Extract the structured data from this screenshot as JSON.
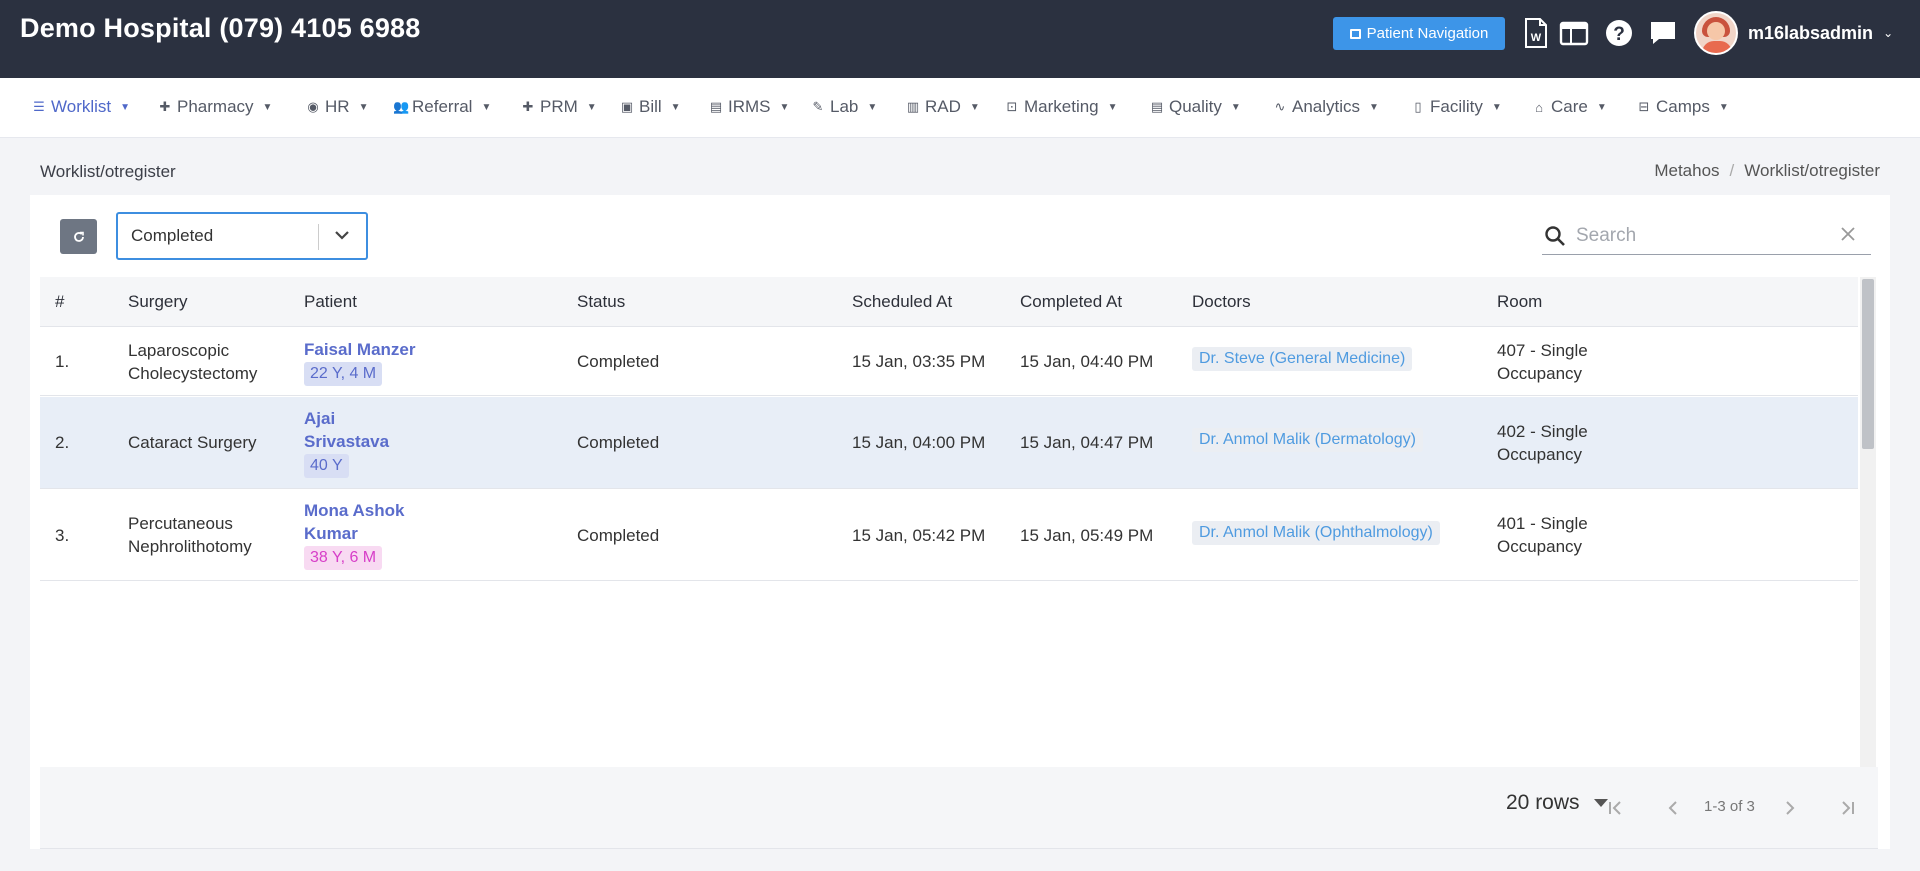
{
  "header": {
    "title": "Demo Hospital (079) 4105 6988",
    "patient_navigation": "Patient Navigation",
    "username": "m16labsadmin"
  },
  "nav": [
    {
      "label": "Worklist",
      "icon": "list-icon"
    },
    {
      "label": "Pharmacy",
      "icon": "plus-icon"
    },
    {
      "label": "HR",
      "icon": "user-circle-icon"
    },
    {
      "label": "Referral",
      "icon": "users-icon"
    },
    {
      "label": "PRM",
      "icon": "plus-icon"
    },
    {
      "label": "Bill",
      "icon": "bill-icon"
    },
    {
      "label": "IRMS",
      "icon": "id-card-icon"
    },
    {
      "label": "Lab",
      "icon": "pen-icon"
    },
    {
      "label": "RAD",
      "icon": "film-icon"
    },
    {
      "label": "Marketing",
      "icon": "bag-icon"
    },
    {
      "label": "Quality",
      "icon": "id-card-icon"
    },
    {
      "label": "Analytics",
      "icon": "pulse-icon"
    },
    {
      "label": "Facility",
      "icon": "building-icon"
    },
    {
      "label": "Care",
      "icon": "store-icon"
    },
    {
      "label": "Camps",
      "icon": "briefcase-icon"
    }
  ],
  "page": {
    "title": "Worklist/otregister",
    "breadcrumb": [
      "Metahos",
      "Worklist/otregister"
    ]
  },
  "filter": {
    "status_selected": "Completed",
    "search_placeholder": "Search"
  },
  "table": {
    "columns": [
      "#",
      "Surgery",
      "Patient",
      "Status",
      "Scheduled At",
      "Completed At",
      "Doctors",
      "Room"
    ],
    "rows": [
      {
        "num": "1.",
        "surgery": [
          "Laparoscopic",
          "Cholecystectomy"
        ],
        "patient": [
          "Faisal Manzer"
        ],
        "age": "22 Y, 4 M",
        "age_style": "blue",
        "status": "Completed",
        "scheduled": "15 Jan, 03:35 PM",
        "completed": "15 Jan, 04:40 PM",
        "doctor": "Dr. Steve (General Medicine)",
        "room": [
          "407 - Single",
          "Occupancy"
        ]
      },
      {
        "num": "2.",
        "surgery": [
          "Cataract Surgery"
        ],
        "patient": [
          "Ajai",
          "Srivastava"
        ],
        "age": "40 Y",
        "age_style": "blue",
        "status": "Completed",
        "scheduled": "15 Jan, 04:00 PM",
        "completed": "15 Jan, 04:47 PM",
        "doctor": "Dr. Anmol Malik (Dermatology)",
        "room": [
          "402 - Single",
          "Occupancy"
        ]
      },
      {
        "num": "3.",
        "surgery": [
          "Percutaneous",
          "Nephrolithotomy"
        ],
        "patient": [
          "Mona Ashok",
          "Kumar"
        ],
        "age": "38 Y, 6 M",
        "age_style": "pink",
        "status": "Completed",
        "scheduled": "15 Jan, 05:42 PM",
        "completed": "15 Jan, 05:49 PM",
        "doctor": "Dr. Anmol Malik (Ophthalmology)",
        "room": [
          "401 - Single",
          "Occupancy"
        ]
      }
    ]
  },
  "pagination": {
    "rows_per_page": "20 rows",
    "range": "1-3 of 3"
  },
  "colors": {
    "header_bg": "#2b3140",
    "accent": "#3d95e8",
    "link": "#5a6ccb",
    "row_highlight": "#e8eef7"
  }
}
